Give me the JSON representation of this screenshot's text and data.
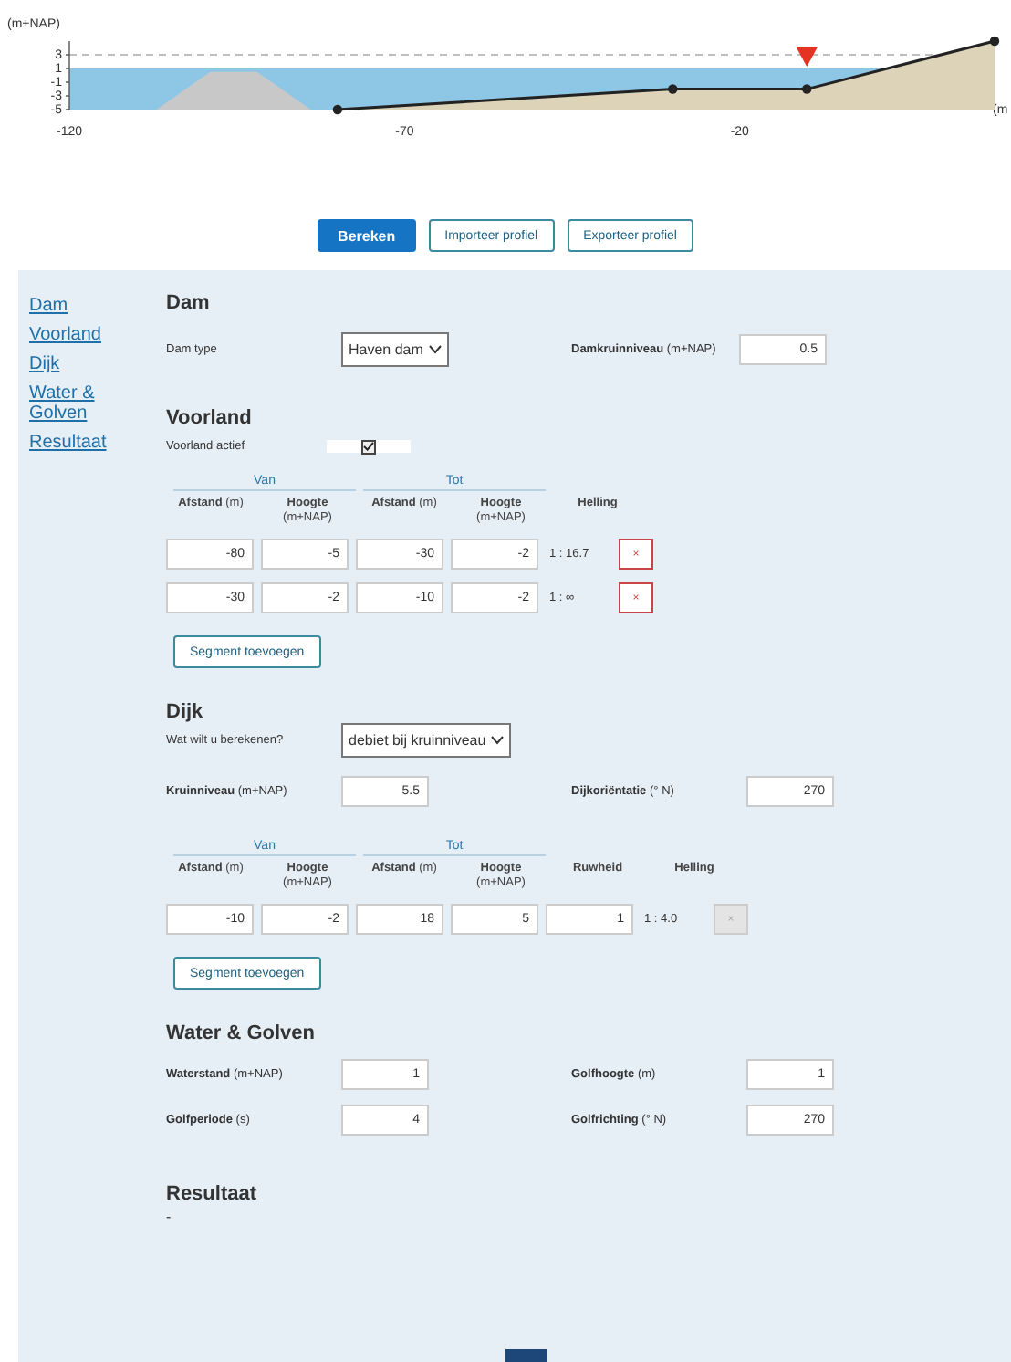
{
  "chart": {
    "chart_data": {
      "type": "line",
      "ylabel": "(m+NAP)",
      "xlabel": "(m",
      "x": [
        -80,
        -30,
        -10,
        18
      ],
      "xlim": [
        -120,
        18
      ],
      "ylim": [
        -5,
        5
      ],
      "series": [
        {
          "color": "#222222",
          "marker": true,
          "values": [
            -5,
            -2,
            -2,
            5
          ]
        }
      ],
      "xticks": [
        -120,
        -70,
        -20
      ],
      "yticks": [
        3,
        1,
        -1,
        -3,
        -5
      ]
    }
  },
  "actions": [
    {
      "label": "Bereken",
      "kind": "primary"
    },
    {
      "label": "Importeer profiel",
      "kind": "secondary"
    },
    {
      "label": "Exporteer profiel",
      "kind": "secondary"
    }
  ],
  "sidebar": {
    "items": [
      "Dam",
      "Voorland",
      "Dijk",
      "Water & Golven",
      "Resultaat"
    ]
  },
  "dam": {
    "title": "Dam",
    "type_label": "Dam type",
    "type_value": "Haven dam",
    "level_label": "**Damkruinniveau** (m+NAP)",
    "level_value": "0.5"
  },
  "voorland": {
    "title": "Voorland",
    "active_label": "Voorland actief",
    "active": true,
    "groups": [
      "Van",
      "Tot"
    ],
    "columns": [
      "**Afstand** (m)",
      "**Hoogte** (m+NAP)",
      "**Afstand** (m)",
      "**Hoogte** (m+NAP)",
      "**Helling**"
    ],
    "rows": [
      {
        "values": [
          "-80",
          "-5",
          "-30",
          "-2"
        ],
        "helling": "1 : 16.7",
        "delete": "×",
        "disabled": false
      },
      {
        "values": [
          "-30",
          "-2",
          "-10",
          "-2"
        ],
        "helling": "1 : ∞",
        "delete": "×",
        "disabled": false
      }
    ],
    "add_button": "Segment toevoegen"
  },
  "dijk": {
    "title": "Dijk",
    "question_label": "Wat wilt u berekenen?",
    "question_value": "debiet bij kruinniveau",
    "fields": [
      {
        "label": "**Kruinniveau** (m+NAP)",
        "value": "5.5"
      },
      {
        "label": "**Dijkoriëntatie** (° N)",
        "value": "270"
      }
    ],
    "groups": [
      "Van",
      "Tot"
    ],
    "columns": [
      "**Afstand** (m)",
      "**Hoogte** (m+NAP)",
      "**Afstand** (m)",
      "**Hoogte** (m+NAP)",
      "**Ruwheid**",
      "**Helling**"
    ],
    "rows": [
      {
        "values": [
          "-10",
          "-2",
          "18",
          "5",
          "1"
        ],
        "helling": "1 : 4.0",
        "delete": "×",
        "disabled": true
      }
    ],
    "add_button": "Segment toevoegen"
  },
  "water": {
    "title": "Water & Golven",
    "fields": [
      {
        "label": "**Waterstand** (m+NAP)",
        "value": "1"
      },
      {
        "label": "**Golfhoogte** (m)",
        "value": "1"
      },
      {
        "label": "**Golfperiode** (s)",
        "value": "4"
      },
      {
        "label": "**Golfrichting** (° N)",
        "value": "270"
      }
    ]
  },
  "resultaat": {
    "title": "Resultaat",
    "text": "-"
  }
}
